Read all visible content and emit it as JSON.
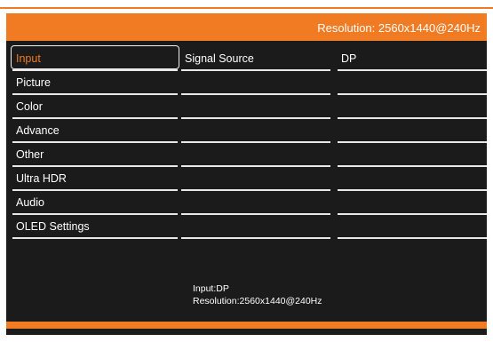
{
  "accent_color": "#f07b22",
  "header": {
    "resolution_text": "Resolution: 2560x1440@240Hz"
  },
  "menu": {
    "items": [
      {
        "label": "Input"
      },
      {
        "label": "Picture"
      },
      {
        "label": "Color"
      },
      {
        "label": "Advance"
      },
      {
        "label": "Other"
      },
      {
        "label": "Ultra HDR"
      },
      {
        "label": "Audio"
      },
      {
        "label": "OLED Settings"
      }
    ],
    "selected_index": 0
  },
  "submenu": {
    "items": [
      "Signal Source",
      "",
      "",
      "",
      "",
      "",
      "",
      ""
    ]
  },
  "values": {
    "items": [
      "DP",
      "",
      "",
      "",
      "",
      "",
      "",
      ""
    ]
  },
  "info": {
    "input_line": "Input:DP",
    "resolution_line": "Resolution:2560x1440@240Hz"
  }
}
